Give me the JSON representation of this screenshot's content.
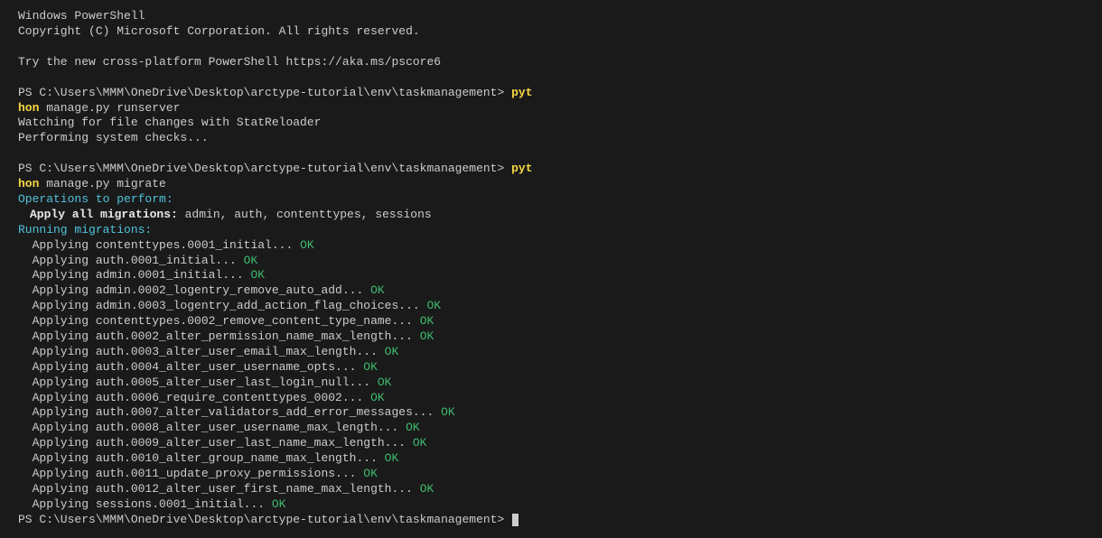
{
  "header": {
    "title": "Windows PowerShell",
    "copyright": "Copyright (C) Microsoft Corporation. All rights reserved.",
    "try_new": "Try the new cross-platform PowerShell https://aka.ms/pscore6"
  },
  "prompt_path": "PS C:\\Users\\MMM\\OneDrive\\Desktop\\arctype-tutorial\\env\\taskmanagement>",
  "cmd1": {
    "part1": "pyt",
    "part2": "hon",
    "args": " manage.py runserver",
    "out1": "Watching for file changes with StatReloader",
    "out2": "Performing system checks..."
  },
  "cmd2": {
    "part1": "pyt",
    "part2": "hon",
    "args": " manage.py migrate"
  },
  "ops": {
    "header": "Operations to perform:",
    "apply_label": "Apply all migrations:",
    "apply_list": " admin, auth, contenttypes, sessions"
  },
  "running": "Running migrations:",
  "ok": "OK",
  "migrations": [
    "  Applying contenttypes.0001_initial... ",
    "  Applying auth.0001_initial... ",
    "  Applying admin.0001_initial... ",
    "  Applying admin.0002_logentry_remove_auto_add... ",
    "  Applying admin.0003_logentry_add_action_flag_choices... ",
    "  Applying contenttypes.0002_remove_content_type_name... ",
    "  Applying auth.0002_alter_permission_name_max_length... ",
    "  Applying auth.0003_alter_user_email_max_length... ",
    "  Applying auth.0004_alter_user_username_opts... ",
    "  Applying auth.0005_alter_user_last_login_null... ",
    "  Applying auth.0006_require_contenttypes_0002... ",
    "  Applying auth.0007_alter_validators_add_error_messages... ",
    "  Applying auth.0008_alter_user_username_max_length... ",
    "  Applying auth.0009_alter_user_last_name_max_length... ",
    "  Applying auth.0010_alter_group_name_max_length... ",
    "  Applying auth.0011_update_proxy_permissions... ",
    "  Applying auth.0012_alter_user_first_name_max_length... ",
    "  Applying sessions.0001_initial... "
  ]
}
